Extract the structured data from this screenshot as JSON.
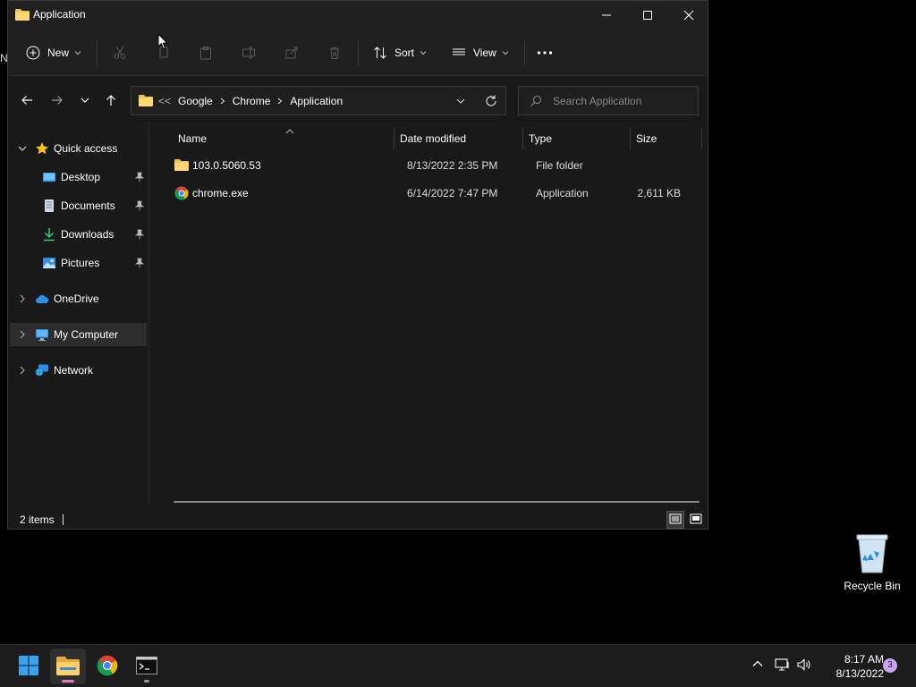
{
  "desktop": {
    "peek_text": "N",
    "recycle_bin_label": "Recycle Bin"
  },
  "window": {
    "title": "Application"
  },
  "toolbar": {
    "new_label": "New",
    "sort_label": "Sort",
    "view_label": "View"
  },
  "address": {
    "lead": "<<",
    "crumbs": [
      "Google",
      "Chrome",
      "Application"
    ],
    "search_placeholder": "Search Application"
  },
  "nav": {
    "quick_access": "Quick access",
    "desktop": "Desktop",
    "documents": "Documents",
    "downloads": "Downloads",
    "pictures": "Pictures",
    "onedrive": "OneDrive",
    "my_computer": "My Computer",
    "network": "Network"
  },
  "columns": {
    "name": "Name",
    "date": "Date modified",
    "type": "Type",
    "size": "Size"
  },
  "files": [
    {
      "name": "103.0.5060.53",
      "date": "8/13/2022 2:35 PM",
      "type": "File folder",
      "size": "",
      "icon": "folder-icon"
    },
    {
      "name": "chrome.exe",
      "date": "6/14/2022 7:47 PM",
      "type": "Application",
      "size": "2,611 KB",
      "icon": "chrome-icon"
    }
  ],
  "status": {
    "item_count": "2 items"
  },
  "taskbar": {
    "time": "8:17 AM",
    "date": "8/13/2022",
    "notification_count": "3"
  },
  "colors": {
    "folder": "#f2c14e",
    "accent_blue": "#3aa0f0",
    "active_indicator": "#e07ab8"
  }
}
